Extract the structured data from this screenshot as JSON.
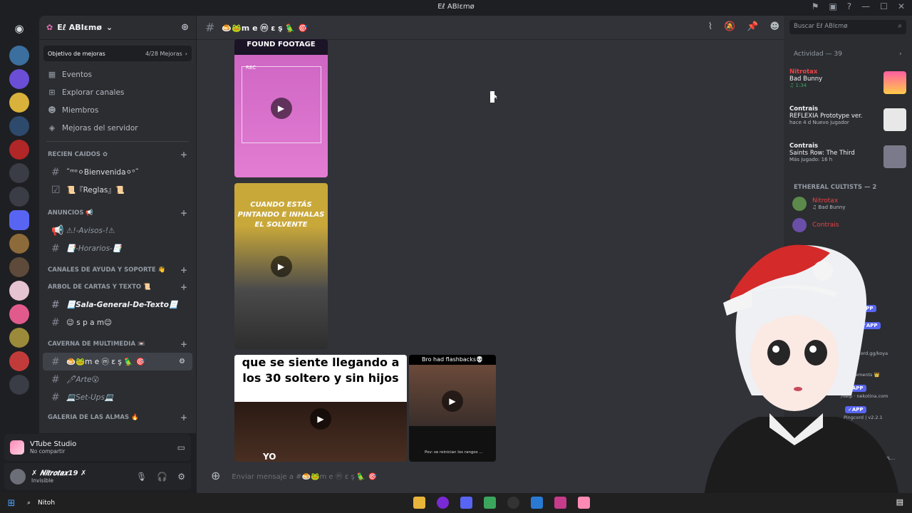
{
  "window": {
    "title": "Eℓ ABIεmø"
  },
  "server": {
    "name": "Eℓ ABIεmø"
  },
  "boost": {
    "label": "Objetivo de mejoras",
    "progress": "4/28 Mejoras"
  },
  "nav": [
    {
      "label": "Eventos",
      "icon": "calendar-icon"
    },
    {
      "label": "Explorar canales",
      "icon": "grid-icon"
    },
    {
      "label": "Miembros",
      "icon": "members-icon"
    },
    {
      "label": "Mejoras del servidor",
      "icon": "boost-icon"
    }
  ],
  "categories": {
    "c1": "RECIEN CAIDOS ✿",
    "c2": "ANUNCIOS 📢",
    "c3": "CANALES DE AYUDA Y SOPORTE 👋",
    "c4": "ARBOL DE CARTAS Y TEXTO 📜",
    "c5": "CAVERNA DE MULTIMEDIA 📼",
    "c6": "GALERIA DE LAS ALMAS 🔥"
  },
  "channels": {
    "bienvenida": "˜ᵐᵒ⚪Bienvenida⚪ᵒ˜",
    "reglas": "📜『Reglas』📜",
    "avisos": "⚠!-Avisos-!⚠",
    "horarios": "📑-Horarios-📑",
    "sala": "📃Sala-General-De-Texto📃",
    "spam": "😉 s p a m😉",
    "memes": "🍮🐸m e ⓜ ε ş 🦜 🎯",
    "arte": "🖊Arte😮",
    "setups": "💻Set-Ups💻"
  },
  "voice": {
    "app": "VTube Studio",
    "status": "No compartir"
  },
  "user": {
    "name": "✗ 𝑵𝒊𝒕𝒓𝒐𝒕𝒂𝒙19 ✗",
    "status": "Invisible"
  },
  "channel_header": {
    "name": "🍮🐸m e ⓜ ε ş 🦜 🎯"
  },
  "media": {
    "m1_caption": "FOUND FOOTAGE",
    "m1_rec": "REC",
    "m2_caption": "CUANDO ESTÁS PINTANDO E INHALAS EL SOLVENTE",
    "m3_caption": "que se siente llegando a los 30 soltero y sin hijos",
    "m3_sub": "YO",
    "m4_caption": "Bro had flashbacks💀",
    "m4_sub": "Pov: se reinician los rangos ..."
  },
  "composer": {
    "placeholder": "Enviar mensaje a #🍮🐸m e ⓜ ε ş 🦜 🎯"
  },
  "search": {
    "placeholder": "Buscar Eℓ ABIεmø"
  },
  "activity": {
    "header": "Actividad — 39",
    "items": [
      {
        "who": "Nitrotax",
        "what": "Bad Bunny",
        "meta": "♫ 1:34"
      },
      {
        "who": "Contrais",
        "what": "REFLEXIA Prototype ver.",
        "meta": "hace 4 d   Nuevo jugador"
      },
      {
        "who": "Contrais",
        "what": "Saints Row: The Third",
        "meta": "Más jugado: 16 h"
      }
    ]
  },
  "group": {
    "label": "ETHEREAL CULTISTS — 2"
  },
  "members": [
    {
      "name": "Nitrotax",
      "sub": "♫ Bad Bunny"
    },
    {
      "name": "Contrais",
      "sub": ""
    }
  ],
  "right_fragments": [
    "cord.gg/koya",
    "ements 👑",
    "/help · nekotina.com",
    "Pingcord | v2.2.1",
    "t HOL..."
  ],
  "app_badge": "✓APP",
  "taskbar": {
    "search": "Nitoh"
  },
  "colors": {
    "accent": "#5865f2",
    "bg_main": "#313338",
    "bg_side": "#2b2d31"
  }
}
